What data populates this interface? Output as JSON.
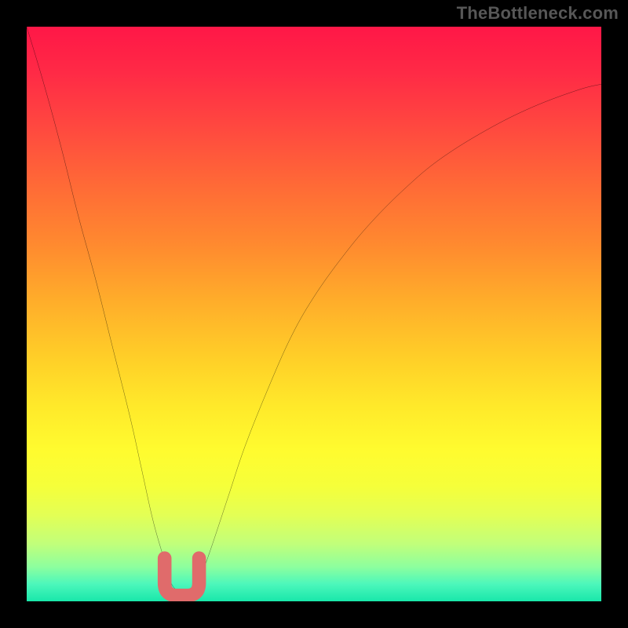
{
  "watermark": "TheBottleneck.com",
  "chart_data": {
    "type": "line",
    "title": "",
    "xlabel": "",
    "ylabel": "",
    "xlim": [
      0,
      100
    ],
    "ylim": [
      0,
      100
    ],
    "grid": false,
    "legend": false,
    "x": [
      0,
      3,
      6,
      9,
      12,
      15,
      18,
      20,
      22,
      24,
      25,
      26,
      27,
      28,
      29,
      30,
      32,
      35,
      38,
      42,
      46,
      50,
      55,
      60,
      66,
      72,
      80,
      88,
      96,
      100
    ],
    "values": [
      100,
      90,
      79,
      67,
      56,
      44,
      32,
      23,
      14,
      7,
      3.5,
      2,
      1.5,
      1.5,
      2,
      3.5,
      9,
      18,
      27,
      37,
      46,
      53,
      60,
      66,
      72,
      77,
      82,
      86,
      89,
      90
    ],
    "annotations": [
      {
        "shape": "u-mark",
        "x1": 24,
        "x2": 30,
        "y": 2,
        "color": "#e06b6b"
      }
    ],
    "gradient_stops": [
      {
        "pos": 0,
        "color": "#ff1747"
      },
      {
        "pos": 18,
        "color": "#ff4a3f"
      },
      {
        "pos": 38,
        "color": "#ff8a2f"
      },
      {
        "pos": 58,
        "color": "#ffd028"
      },
      {
        "pos": 74,
        "color": "#fffc2f"
      },
      {
        "pos": 90,
        "color": "#c1ff7a"
      },
      {
        "pos": 100,
        "color": "#19e7aa"
      }
    ]
  }
}
